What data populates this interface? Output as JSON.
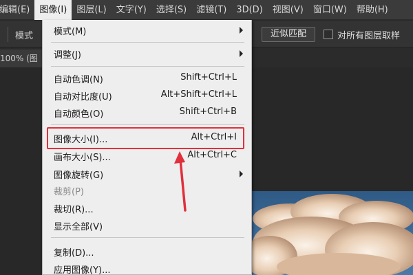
{
  "menubar": {
    "items": [
      {
        "label": "编辑(E)"
      },
      {
        "label": "图像(I)"
      },
      {
        "label": "图层(L)"
      },
      {
        "label": "文字(Y)"
      },
      {
        "label": "选择(S)"
      },
      {
        "label": "滤镜(T)"
      },
      {
        "label": "3D(D)"
      },
      {
        "label": "视图(V)"
      },
      {
        "label": "窗口(W)"
      },
      {
        "label": "帮助(H)"
      }
    ]
  },
  "options_bar": {
    "mode_label": "模式",
    "match_button": "近似匹配",
    "sample_all_layers_label": "对所有图层取样"
  },
  "document": {
    "tab_label": "100% (图"
  },
  "image_menu": {
    "items": [
      {
        "label": "模式(M)",
        "shortcut": ""
      },
      {
        "label": "调整(J)",
        "shortcut": ""
      },
      {
        "label": "自动色调(N)",
        "shortcut": "Shift+Ctrl+L"
      },
      {
        "label": "自动对比度(U)",
        "shortcut": "Alt+Shift+Ctrl+L"
      },
      {
        "label": "自动颜色(O)",
        "shortcut": "Shift+Ctrl+B"
      },
      {
        "label": "图像大小(I)...",
        "shortcut": "Alt+Ctrl+I"
      },
      {
        "label": "画布大小(S)...",
        "shortcut": "Alt+Ctrl+C"
      },
      {
        "label": "图像旋转(G)",
        "shortcut": ""
      },
      {
        "label": "裁剪(P)",
        "shortcut": ""
      },
      {
        "label": "裁切(R)...",
        "shortcut": ""
      },
      {
        "label": "显示全部(V)",
        "shortcut": ""
      },
      {
        "label": "复制(D)...",
        "shortcut": ""
      },
      {
        "label": "应用图像(Y)...",
        "shortcut": ""
      }
    ]
  },
  "colors": {
    "highlight": "#e0303c",
    "menu_bg": "#eeeeee",
    "app_bg": "#282828"
  },
  "icons": {
    "submenu_arrow": "chevron-right-icon",
    "annotation_arrow": "red-arrow-icon"
  }
}
